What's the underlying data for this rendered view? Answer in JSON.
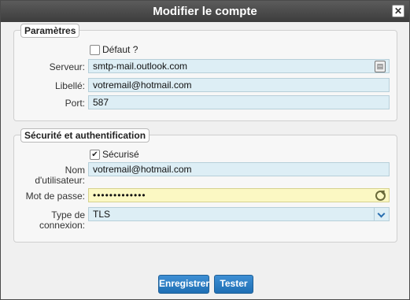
{
  "dialog": {
    "title": "Modifier le compte",
    "close_glyph": "✕"
  },
  "parametres": {
    "legend": "Paramètres",
    "default_checkbox": {
      "label": "Défaut ?",
      "checked": false
    },
    "server": {
      "label": "Serveur:",
      "value": "smtp-mail.outlook.com",
      "icon": "address-book-icon"
    },
    "libelle": {
      "label": "Libellé:",
      "value": "votremail@hotmail.com"
    },
    "port": {
      "label": "Port:",
      "value": "587"
    }
  },
  "securite": {
    "legend": "Sécurité et authentification",
    "secure_checkbox": {
      "label": "Sécurisé",
      "checked": true,
      "glyph": "✔"
    },
    "username": {
      "label": "Nom d'utilisateur:",
      "value": "votremail@hotmail.com"
    },
    "password": {
      "label": "Mot de passe:",
      "value": "•••••••••••••",
      "icon": "refresh-icon"
    },
    "connection_type": {
      "label": "Type de connexion:",
      "value": "TLS"
    }
  },
  "footer": {
    "save_label": "Enregistrer",
    "test_label": "Tester"
  },
  "colors": {
    "title_bar": "#3c3c3c",
    "input_bg": "#ddeef5",
    "password_bg": "#fbf8c3",
    "button": "#2a7cc7"
  }
}
